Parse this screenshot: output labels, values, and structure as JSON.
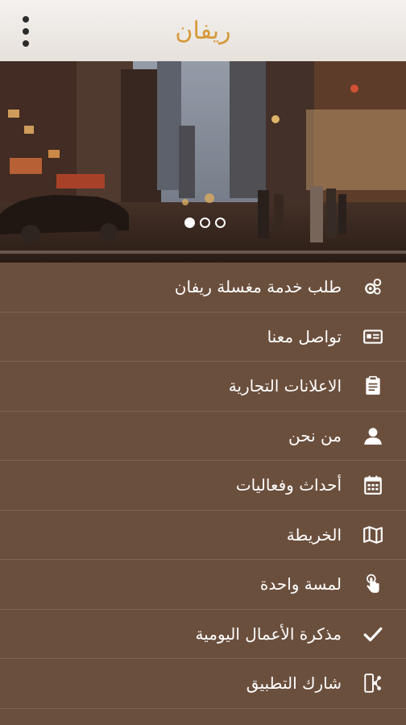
{
  "header": {
    "title": "ريفان"
  },
  "colors": {
    "header_bg": "#eee9e4",
    "title": "#d59a3a",
    "menu_bg": "#6b4f3d"
  },
  "carousel": {
    "pages": 3,
    "active_page": 1
  },
  "menu": [
    {
      "label": "طلب خدمة مغسلة ريفان",
      "icon": "gears-icon"
    },
    {
      "label": "تواصل معنا",
      "icon": "contact-card-icon"
    },
    {
      "label": "الاعلانات التجارية",
      "icon": "clipboard-icon"
    },
    {
      "label": "من نحن",
      "icon": "user-icon"
    },
    {
      "label": "أحداث وفعاليات",
      "icon": "calendar-icon"
    },
    {
      "label": "الخريطة",
      "icon": "map-icon"
    },
    {
      "label": "لمسة واحدة",
      "icon": "touch-icon"
    },
    {
      "label": "مذكرة الأعمال اليومية",
      "icon": "checkmark-icon"
    },
    {
      "label": "شارك التطبيق",
      "icon": "share-icon"
    }
  ]
}
